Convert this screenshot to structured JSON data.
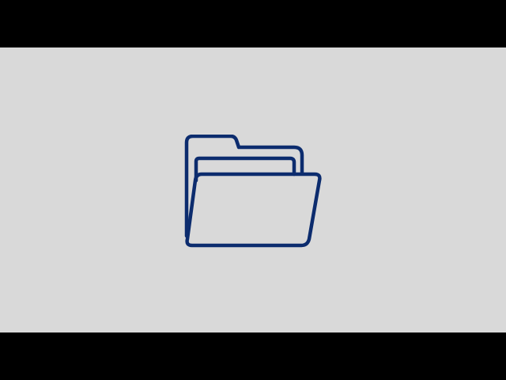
{
  "colors": {
    "letterbox": "#000000",
    "background": "#d9d9d9",
    "icon_stroke": "#0c2c6e"
  },
  "icon": {
    "name": "open-folder-icon"
  }
}
